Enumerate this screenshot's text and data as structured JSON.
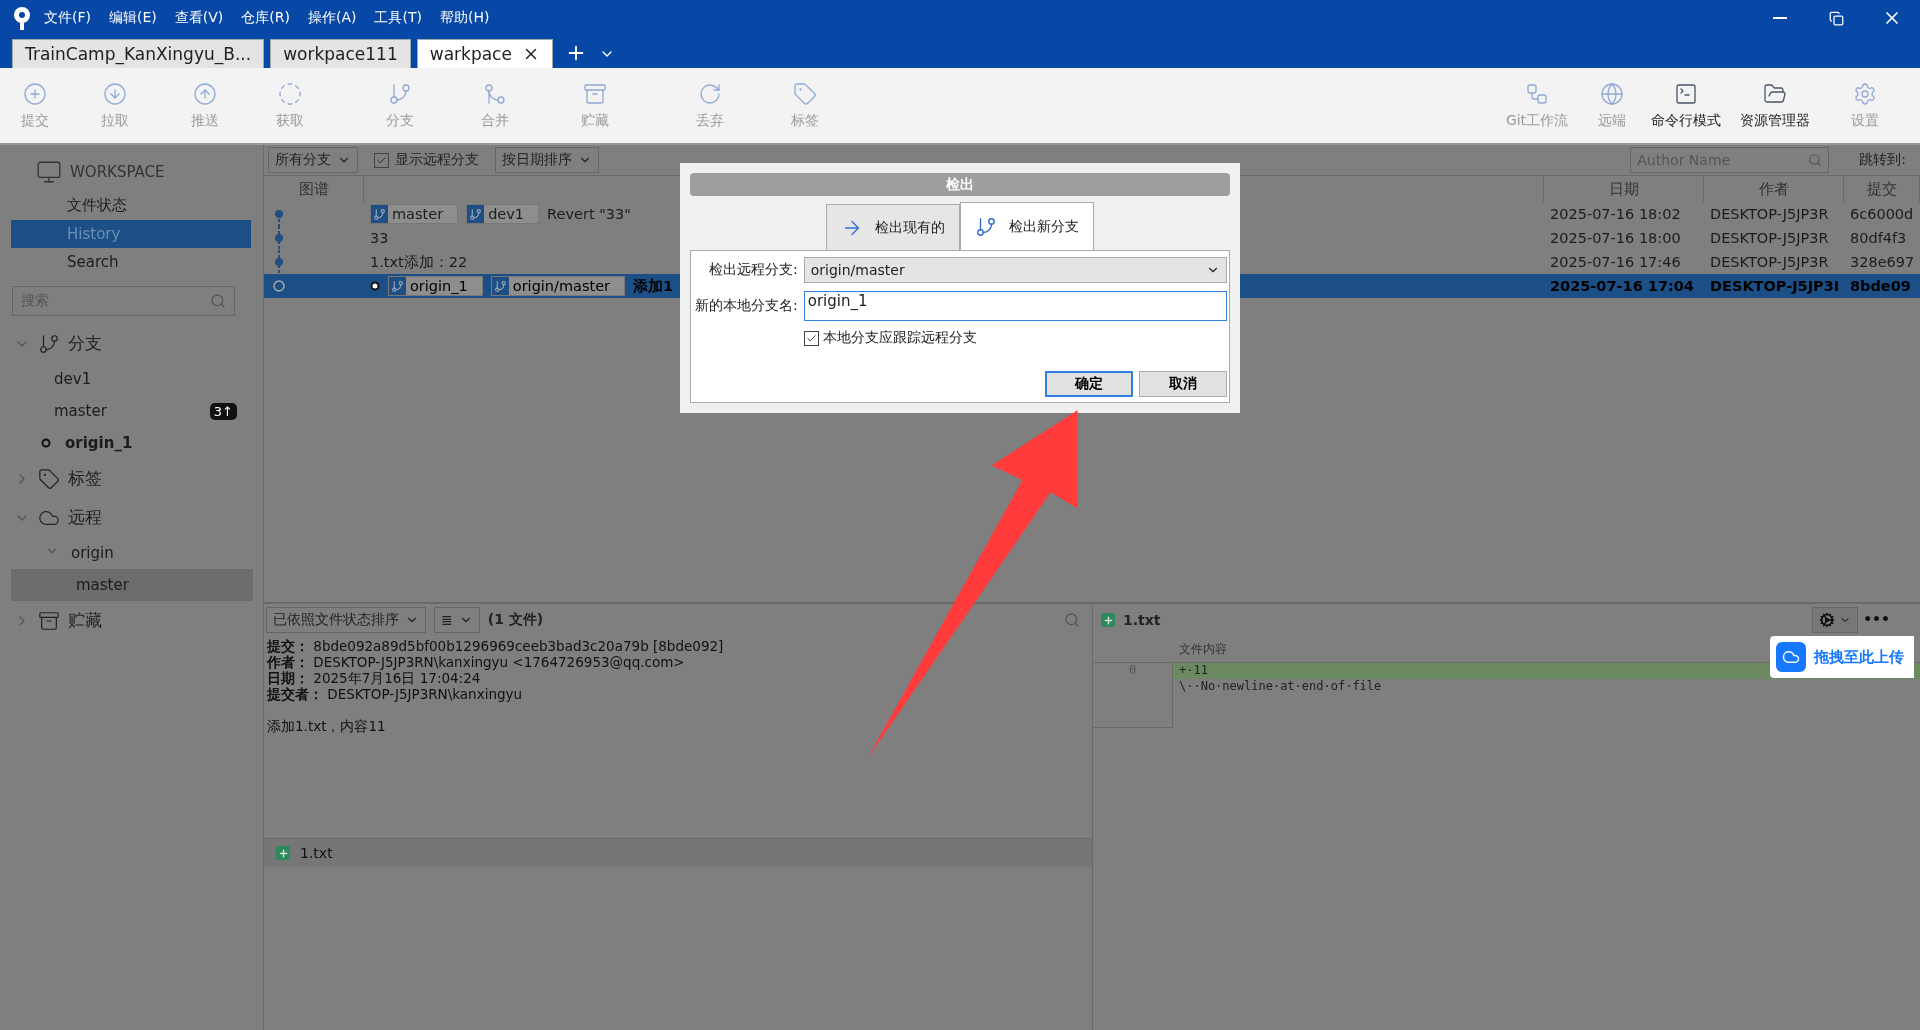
{
  "menu": [
    "文件(F)",
    "编辑(E)",
    "查看(V)",
    "仓库(R)",
    "操作(A)",
    "工具(T)",
    "帮助(H)"
  ],
  "tabs": [
    {
      "label": "TrainCamp_KanXingyu_B...",
      "selected": false
    },
    {
      "label": "workpace111",
      "selected": false
    },
    {
      "label": "warkpace",
      "selected": true
    }
  ],
  "toolbar": {
    "left": [
      {
        "label": "提交",
        "kind": "commit",
        "disabled": true
      },
      {
        "label": "拉取",
        "kind": "pull",
        "disabled": true
      },
      {
        "label": "推送",
        "kind": "push",
        "disabled": true
      },
      {
        "label": "获取",
        "kind": "fetch",
        "disabled": true
      },
      {
        "label": "分支",
        "kind": "branch",
        "disabled": true
      },
      {
        "label": "合并",
        "kind": "merge",
        "disabled": true
      },
      {
        "label": "贮藏",
        "kind": "stash",
        "disabled": true
      },
      {
        "label": "丢弃",
        "kind": "discard",
        "disabled": true
      },
      {
        "label": "标签",
        "kind": "tag",
        "disabled": true
      }
    ],
    "right": [
      {
        "label": "Git工作流",
        "kind": "flow",
        "disabled": true
      },
      {
        "label": "远端",
        "kind": "remote",
        "disabled": true
      },
      {
        "label": "命令行模式",
        "kind": "terminal",
        "disabled": false
      },
      {
        "label": "资源管理器",
        "kind": "explorer",
        "disabled": false
      },
      {
        "label": "设置",
        "kind": "settings",
        "disabled": true
      }
    ]
  },
  "sidebar": {
    "workspace": "WORKSPACE",
    "items": [
      {
        "label": "文件状态",
        "selected": false
      },
      {
        "label": "History",
        "selected": true
      },
      {
        "label": "Search",
        "selected": false
      }
    ],
    "search": {
      "placeholder": "搜索"
    },
    "sections": [
      {
        "label": "分支",
        "kind": "branches",
        "expanded": true,
        "children": [
          {
            "label": "dev1",
            "current": false
          },
          {
            "label": "master",
            "current": false,
            "badge": "3↑"
          },
          {
            "label": "origin_1",
            "current": true
          }
        ]
      },
      {
        "label": "标签",
        "kind": "tags",
        "expanded": false
      },
      {
        "label": "远程",
        "kind": "remotes",
        "expanded": true,
        "children": [
          {
            "label": "origin",
            "expanded": true,
            "children": [
              {
                "label": "master",
                "selected": true
              }
            ]
          }
        ]
      },
      {
        "label": "贮藏",
        "kind": "stashes",
        "expanded": false
      }
    ]
  },
  "filters": {
    "branches": "所有分支",
    "show_remote": {
      "label": "显示远程分支",
      "checked": true
    },
    "sort": "按日期排序",
    "author": {
      "placeholder": "Author Name"
    },
    "jump": "跳转到:"
  },
  "commits": {
    "columns": [
      "图谱",
      "日期",
      "作者",
      "提交"
    ],
    "rows": [
      {
        "refs": [
          {
            "name": "master"
          },
          {
            "name": "dev1"
          }
        ],
        "message": "Revert \"33\"",
        "date": "2025-07-16 18:02",
        "author": "DESKTOP-J5JP3R",
        "hash": "6c6000d",
        "selected": false,
        "head": false
      },
      {
        "refs": [],
        "message": "33",
        "date": "2025-07-16 18:00",
        "author": "DESKTOP-J5JP3R",
        "hash": "80df4f3",
        "selected": false,
        "head": false
      },
      {
        "refs": [],
        "message": "1.txt添加：22",
        "date": "2025-07-16 17:46",
        "author": "DESKTOP-J5JP3R",
        "hash": "328e697",
        "selected": false,
        "head": false
      },
      {
        "refs": [
          {
            "name": "origin_1"
          },
          {
            "name": "origin/master"
          }
        ],
        "message": "添加1",
        "date": "2025-07-16 17:04",
        "author": "DESKTOP-J5JP3I",
        "hash": "8bde09",
        "selected": true,
        "head": true
      }
    ]
  },
  "details": {
    "sort": "已依照文件状态排序",
    "view": "≣",
    "count": "(1 文件)",
    "fields": [
      {
        "label": "提交：",
        "value": "8bde092a89d5bf00b1296969ceeb3bad3c20a79b [8bde092]"
      },
      {
        "label": "作者：",
        "value": "DESKTOP-J5JP3RN\\kanxingyu <1764726953@qq.com>"
      },
      {
        "label": "日期：",
        "value": "2025年7月16日 17:04:24"
      },
      {
        "label": "提交者：",
        "value": "DESKTOP-J5JP3RN\\kanxingyu"
      }
    ],
    "message": "添加1.txt，内容11",
    "files": [
      "1.txt"
    ]
  },
  "diff": {
    "file": "1.txt",
    "column": "文件内容",
    "more": "•••",
    "line_numbers": [
      "0"
    ],
    "lines": [
      {
        "kind": "added",
        "text": "+·11"
      },
      {
        "kind": "context",
        "text": "\\··No·newline·at·end·of·file"
      }
    ]
  },
  "upload": "拖拽至此上传",
  "dialog": {
    "title": "检出",
    "tabs": [
      {
        "label": "检出现有的",
        "kind": "existing",
        "selected": false
      },
      {
        "label": "检出新分支",
        "kind": "new",
        "selected": true
      }
    ],
    "remote_label": "检出远程分支:",
    "remote_value": "origin/master",
    "name_label": "新的本地分支名:",
    "name_value": "origin_1",
    "track": {
      "label": "本地分支应跟踪远程分支",
      "checked": true
    },
    "buttons": [
      {
        "label": "确定",
        "default": true
      },
      {
        "label": "取消",
        "default": false
      }
    ]
  }
}
